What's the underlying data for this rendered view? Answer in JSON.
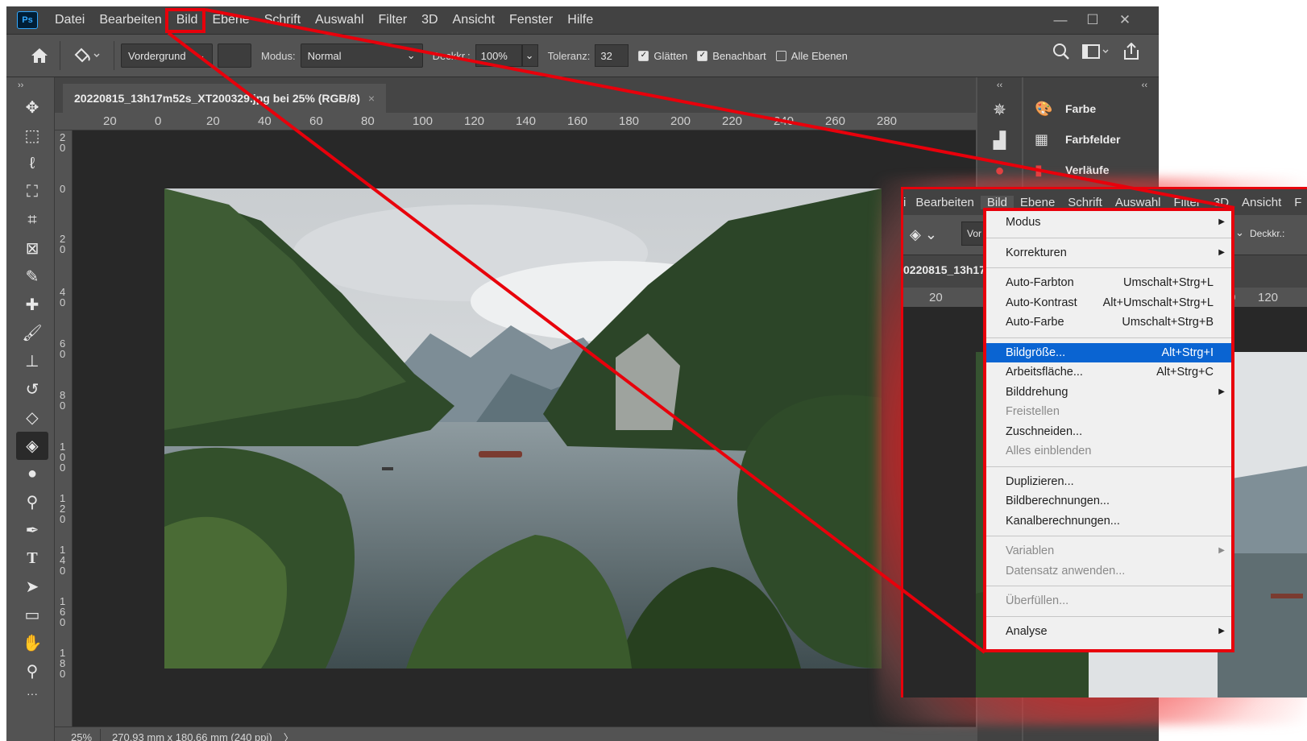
{
  "menubar": {
    "logo": "Ps",
    "items": [
      "Datei",
      "Bearbeiten",
      "Bild",
      "Ebene",
      "Schrift",
      "Auswahl",
      "Filter",
      "3D",
      "Ansicht",
      "Fenster",
      "Hilfe"
    ],
    "window_controls": [
      "—",
      "☐",
      "✕"
    ]
  },
  "options": {
    "fill_source": "Vordergrund",
    "mode_label": "Modus:",
    "mode_value": "Normal",
    "opacity_label": "Deckkr.:",
    "opacity_value": "100%",
    "tolerance_label": "Toleranz:",
    "tolerance_value": "32",
    "antialias_label": "Glätten",
    "contiguous_label": "Benachbart",
    "all_layers_label": "Alle Ebenen",
    "antialias_checked": true,
    "contiguous_checked": true,
    "all_layers_checked": false
  },
  "document": {
    "tab_title": "20220815_13h17m52s_XT200329.jpg bei 25% (RGB/8)",
    "close": "×",
    "ruler_h": [
      "20",
      "0",
      "20",
      "40",
      "60",
      "80",
      "100",
      "120",
      "140",
      "160",
      "180",
      "200",
      "220",
      "240",
      "260",
      "280"
    ],
    "ruler_v": [
      "20",
      "0",
      "20",
      "40",
      "60",
      "80",
      "100",
      "120",
      "140",
      "160",
      "180"
    ]
  },
  "status": {
    "zoom": "25%",
    "info": "270,93 mm x 180,66 mm (240 ppi)",
    "more": "〉"
  },
  "panels": {
    "collapse_left": "‹‹",
    "collapse_right": "‹‹",
    "items": [
      "Farbe",
      "Farbfelder",
      "Verläufe"
    ]
  },
  "toolbar": {
    "expand": "››",
    "tools": [
      "move-icon",
      "marquee-icon",
      "lasso-icon",
      "quick-select-icon",
      "crop-icon",
      "frame-icon",
      "eyedropper-icon",
      "healing-icon",
      "brush-icon",
      "stamp-icon",
      "history-brush-icon",
      "eraser-icon",
      "paint-bucket-icon",
      "blur-icon",
      "dodge-icon",
      "pen-icon",
      "type-icon",
      "path-select-icon",
      "rectangle-icon",
      "hand-icon",
      "zoom-icon"
    ],
    "more": "···"
  },
  "inset": {
    "menubar": [
      "i",
      "Bearbeiten",
      "Bild",
      "Ebene",
      "Schrift",
      "Auswahl",
      "Filter",
      "3D",
      "Ansicht",
      "F"
    ],
    "option_fragments": [
      "Vor",
      "Deckkr.:"
    ],
    "doc_fragment": "0220815_13h17",
    "ruler": [
      "20",
      "0",
      "120"
    ]
  },
  "image_menu": {
    "groups": [
      [
        {
          "label": "Modus",
          "submenu": true
        }
      ],
      [
        {
          "label": "Korrekturen",
          "submenu": true
        }
      ],
      [
        {
          "label": "Auto-Farbton",
          "shortcut": "Umschalt+Strg+L"
        },
        {
          "label": "Auto-Kontrast",
          "shortcut": "Alt+Umschalt+Strg+L"
        },
        {
          "label": "Auto-Farbe",
          "shortcut": "Umschalt+Strg+B"
        }
      ],
      [
        {
          "label": "Bildgröße...",
          "shortcut": "Alt+Strg+I",
          "selected": true
        },
        {
          "label": "Arbeitsfläche...",
          "shortcut": "Alt+Strg+C"
        },
        {
          "label": "Bilddrehung",
          "submenu": true
        },
        {
          "label": "Freistellen",
          "disabled": true
        },
        {
          "label": "Zuschneiden..."
        },
        {
          "label": "Alles einblenden",
          "disabled": true
        }
      ],
      [
        {
          "label": "Duplizieren..."
        },
        {
          "label": "Bildberechnungen..."
        },
        {
          "label": "Kanalberechnungen..."
        }
      ],
      [
        {
          "label": "Variablen",
          "submenu": true,
          "disabled": true
        },
        {
          "label": "Datensatz anwenden...",
          "disabled": true
        }
      ],
      [
        {
          "label": "Überfüllen...",
          "disabled": true
        }
      ],
      [
        {
          "label": "Analyse",
          "submenu": true
        }
      ]
    ]
  },
  "colors": {
    "highlight": "#e8000b",
    "selection": "#0a64d2",
    "ui_dark": "#535353",
    "canvas": "#282828"
  }
}
